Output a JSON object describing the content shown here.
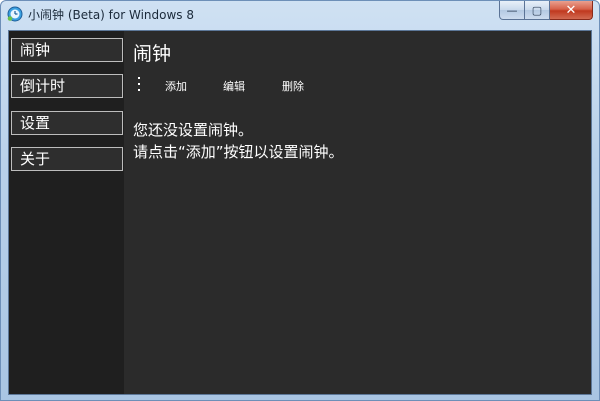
{
  "window": {
    "title": "小闹钟 (Beta) for Windows 8",
    "controls": {
      "minimize": "—",
      "maximize": "▢",
      "close": "✕"
    }
  },
  "sidebar": {
    "items": [
      {
        "label": "闹钟"
      },
      {
        "label": "倒计时"
      },
      {
        "label": "设置"
      },
      {
        "label": "关于"
      }
    ]
  },
  "main": {
    "title": "闹钟",
    "commands": {
      "add": "添加",
      "edit": "编辑",
      "delete": "删除"
    },
    "empty_line1": "您还没设置闹钟。",
    "empty_line2": "请点击“添加”按钮以设置闹钟。"
  },
  "colors": {
    "sidebar_bg": "#1f1f1f",
    "content_bg": "#2b2b2b",
    "text": "#ffffff",
    "close_red": "#c0391f"
  }
}
